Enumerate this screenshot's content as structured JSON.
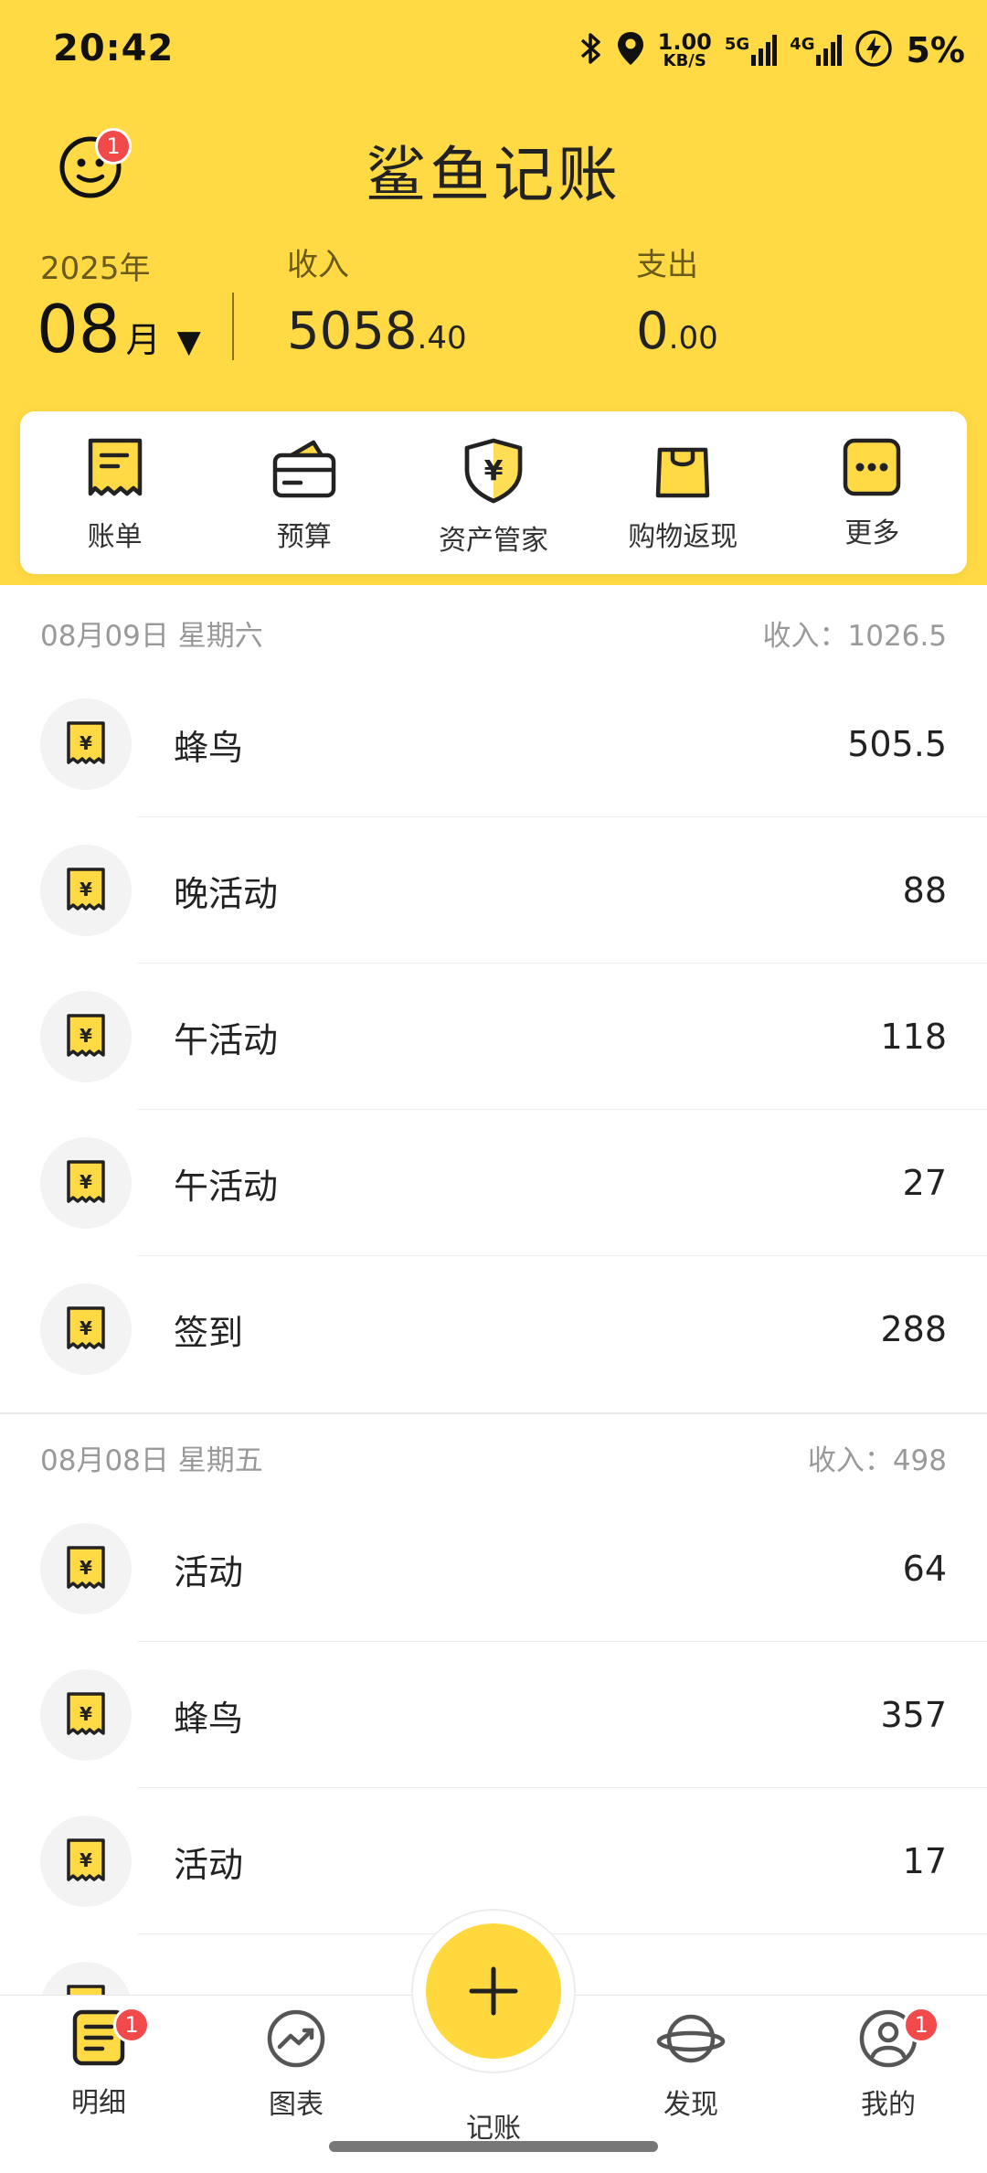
{
  "status_bar": {
    "time": "20:42",
    "net_speed_top": "1.00",
    "net_speed_unit": "KB/S",
    "sig1": "5G",
    "sig2": "4G",
    "battery": "5%"
  },
  "header": {
    "app_title": "鲨鱼记账",
    "avatar_badge": "1"
  },
  "summary": {
    "year": "2025年",
    "month": "08",
    "month_unit": "月",
    "income_label": "收入",
    "income_int": "5058",
    "income_dec": ".40",
    "expense_label": "支出",
    "expense_int": "0",
    "expense_dec": ".00"
  },
  "quick_actions": [
    {
      "label": "账单",
      "icon": "bill-icon"
    },
    {
      "label": "预算",
      "icon": "budget-wallet-icon"
    },
    {
      "label": "资产管家",
      "icon": "asset-shield-icon"
    },
    {
      "label": "购物返现",
      "icon": "shopping-bag-icon"
    },
    {
      "label": "更多",
      "icon": "more-icon"
    }
  ],
  "days": [
    {
      "date": "08月09日 星期六",
      "summary": "收入：1026.5",
      "items": [
        {
          "name": "蜂鸟",
          "amount": "505.5"
        },
        {
          "name": "晚活动",
          "amount": "88"
        },
        {
          "name": "午活动",
          "amount": "118"
        },
        {
          "name": "午活动",
          "amount": "27"
        },
        {
          "name": "签到",
          "amount": "288"
        }
      ]
    },
    {
      "date": "08月08日 星期五",
      "summary": "收入：498",
      "items": [
        {
          "name": "活动",
          "amount": "64"
        },
        {
          "name": "蜂鸟",
          "amount": "357"
        },
        {
          "name": "活动",
          "amount": "17"
        }
      ]
    }
  ],
  "bottom_nav": {
    "details": {
      "label": "明细",
      "badge": "1"
    },
    "charts": {
      "label": "图表"
    },
    "record": {
      "label": "记账"
    },
    "discover": {
      "label": "发现"
    },
    "mine": {
      "label": "我的",
      "badge": "1"
    }
  },
  "colors": {
    "brand_yellow": "#FFDA44",
    "badge_red": "#F2494B"
  }
}
